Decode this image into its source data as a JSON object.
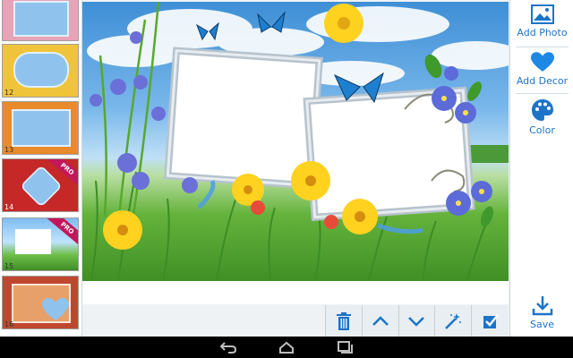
{
  "thumbnails": [
    {
      "name": "frame-pink-flowers",
      "number": "",
      "pro": false,
      "bg": "#e8a3b8",
      "accent": "#f4d6e0"
    },
    {
      "name": "frame-yellow-flowers",
      "number": "12",
      "pro": false,
      "bg": "#f0c43a",
      "accent": "#fff1a6"
    },
    {
      "name": "frame-orange",
      "number": "13",
      "pro": false,
      "bg": "#e98a2b",
      "accent": "#ffd089"
    },
    {
      "name": "frame-red-ornate",
      "number": "14",
      "pro": true,
      "pro_label": "PRO",
      "bg": "#c62828",
      "accent": "#ef9a9a"
    },
    {
      "name": "frame-spring-meadow",
      "number": "15",
      "pro": true,
      "pro_label": "PRO",
      "bg": "#6fbf4b",
      "accent": "#bfe3ff"
    },
    {
      "name": "frame-heart-red",
      "number": "16",
      "pro": false,
      "bg": "#c0472f",
      "accent": "#e8a06a"
    }
  ],
  "side_panel": {
    "add_photo": "Add Photo",
    "add_decor": "Add Decor",
    "color": "Color",
    "save": "Save"
  },
  "toolbar": {
    "icons": [
      "trash-icon",
      "chevron-up-icon",
      "chevron-down-icon",
      "magic-wand-icon",
      "checkbox-icon"
    ]
  },
  "colors": {
    "accent": "#1c74c8",
    "heart": "#1e88e5"
  }
}
